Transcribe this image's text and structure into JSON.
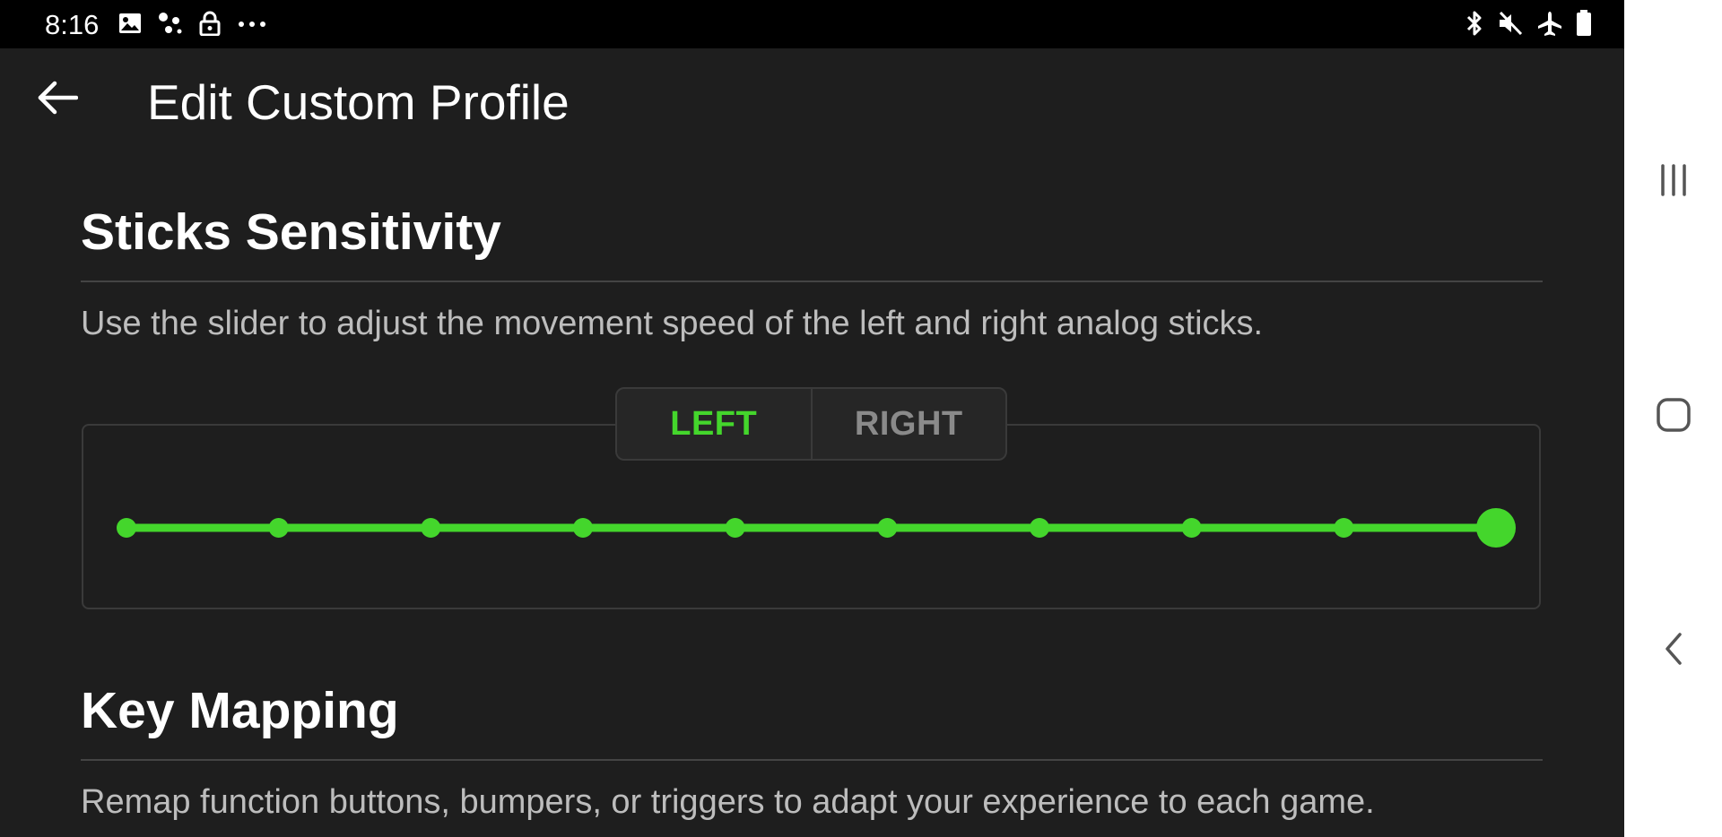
{
  "status_bar": {
    "time": "8:16",
    "left_icons": [
      "image-icon",
      "dots-network-icon",
      "lock-icon",
      "more-horizontal-icon"
    ],
    "right_icons": [
      "bluetooth-icon",
      "mute-icon",
      "airplane-mode-icon",
      "battery-icon"
    ]
  },
  "header": {
    "title": "Edit Custom Profile",
    "back_icon": "arrow-left-icon"
  },
  "sticks_section": {
    "title": "Sticks Sensitivity",
    "description": "Use the slider to adjust the movement speed of the left and right analog sticks.",
    "tabs": [
      {
        "label": "LEFT",
        "active": true
      },
      {
        "label": "RIGHT",
        "active": false
      }
    ],
    "slider": {
      "steps": 10,
      "selected_step": 10,
      "accent_color": "#44d62c"
    }
  },
  "key_mapping_section": {
    "title": "Key Mapping",
    "description": "Remap function buttons, bumpers, or triggers to adapt your experience to each game."
  },
  "nav_bar": {
    "buttons": [
      "recent-apps-icon",
      "home-icon",
      "back-chevron-icon"
    ]
  },
  "colors": {
    "background": "#1e1e1e",
    "accent": "#44d62c",
    "status_bar": "#000000",
    "nav_bar": "#ffffff"
  }
}
